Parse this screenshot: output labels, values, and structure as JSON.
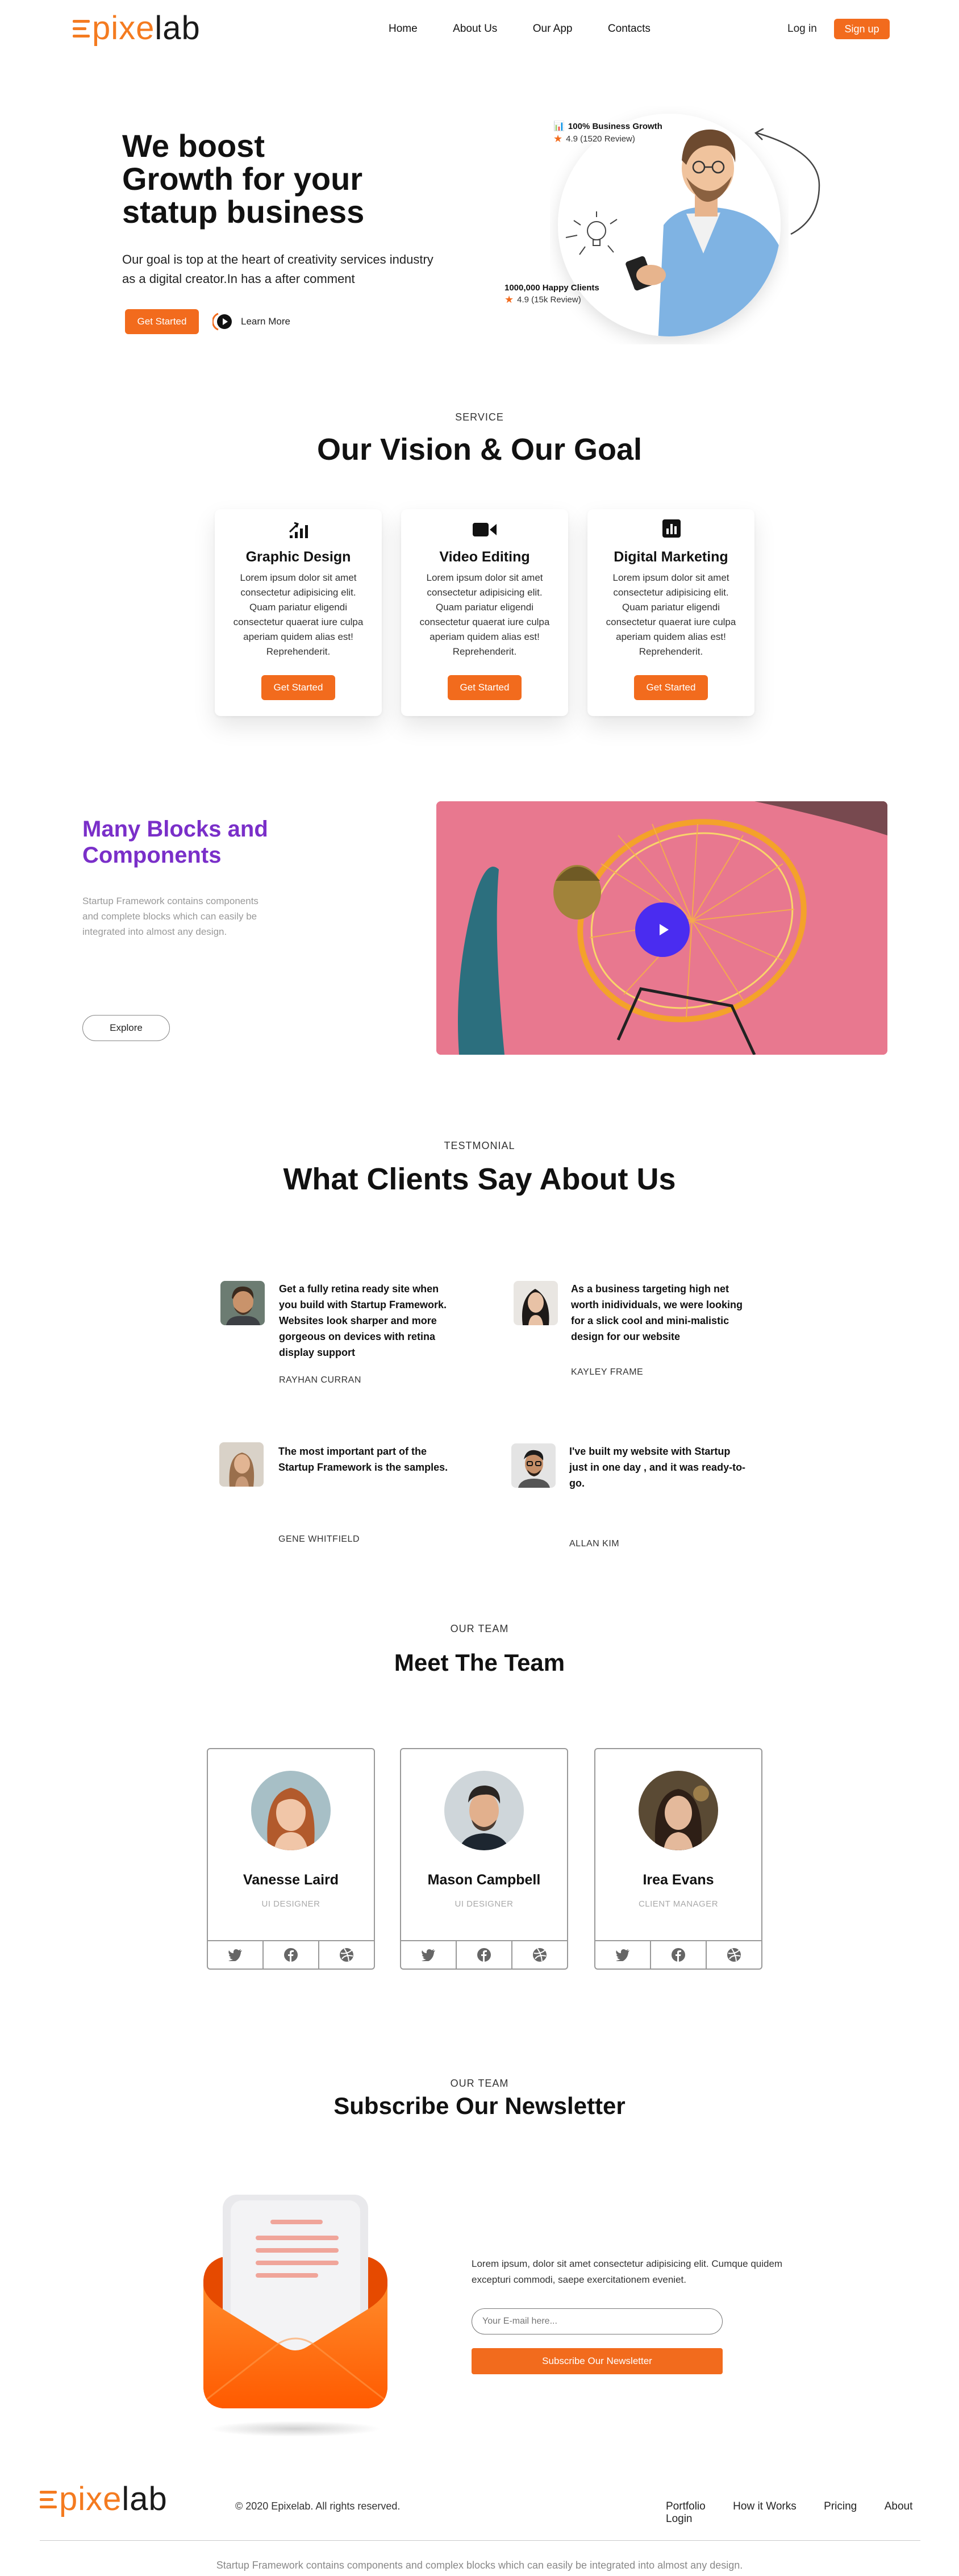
{
  "brand": {
    "logo_main": "pixe",
    "logo_tail": "lab"
  },
  "header": {
    "nav": [
      "Home",
      "About Us",
      "Our App",
      "Contacts"
    ],
    "login": "Log in",
    "signup": "Sign up"
  },
  "hero": {
    "title_line1": "We boost",
    "title_line2": "Growth for your",
    "title_line3": "statup business",
    "desc_line1": "Our goal is top at the heart of creativity services industry",
    "desc_line2": "as a digital creator.In has a after comment",
    "cta": "Get Started",
    "learn_more": "Learn More",
    "badge1_title": "100% Business Growth",
    "badge1_rating": "4.9 (1520 Review)",
    "badge2_title": "1000,000 Happy Clients",
    "badge2_rating": "4.9 (15k Review)"
  },
  "service": {
    "tag": "SERVICE",
    "title": "Our Vision & Our Goal",
    "cards": [
      {
        "title": "Graphic Design",
        "l1": "Lorem ipsum dolor sit amet",
        "l2": "consectetur adipisicing elit.",
        "l3": "Quam pariatur eligendi",
        "l4": "consectetur quaerat iure culpa",
        "l5": "aperiam quidem alias est!",
        "l6": "Reprehenderit.",
        "cta": "Get Started",
        "icon": "chart-scatter-icon"
      },
      {
        "title": "Video Editing",
        "l1": "Lorem ipsum dolor sit amet",
        "l2": "consectetur adipisicing elit.",
        "l3": "Quam pariatur eligendi",
        "l4": "consectetur quaerat iure culpa",
        "l5": "aperiam quidem alias est!",
        "l6": "Reprehenderit.",
        "cta": "Get Started",
        "icon": "video-camera-icon"
      },
      {
        "title": "Digital Marketing",
        "l1": "Lorem ipsum dolor sit amet",
        "l2": "consectetur adipisicing elit.",
        "l3": "Quam pariatur eligendi",
        "l4": "consectetur quaerat iure culpa",
        "l5": "aperiam quidem alias est!",
        "l6": "Reprehenderit.",
        "cta": "Get Started",
        "icon": "bar-chart-icon"
      }
    ]
  },
  "blocks": {
    "title_line1": "Many Blocks and",
    "title_line2": "Components",
    "desc_line1": "Startup Framework contains components",
    "desc_line2": "and complete blocks which can easily be",
    "desc_line3": "integrated into almost any design.",
    "explore": "Explore"
  },
  "testimonial": {
    "tag": "TESTMONIAL",
    "title": "What Clients Say About Us",
    "items": [
      {
        "l1": "Get a fully retina ready site when",
        "l2": "you build with Startup Framework.",
        "l3": "Websites look sharper and more",
        "l4": "gorgeous on devices with retina",
        "l5": "display support",
        "name": "RAYHAN CURRAN"
      },
      {
        "l1": "As a business targeting high net",
        "l2": "worth inidividuals, we were looking",
        "l3": "for a slick cool and mini-malistic",
        "l4": "design for our website",
        "l5": "",
        "name": "KAYLEY FRAME"
      },
      {
        "l1": "The most important part of the",
        "l2": "Startup Framework is the samples.",
        "l3": "",
        "l4": "",
        "l5": "",
        "name": "GENE WHITFIELD"
      },
      {
        "l1": "I've built my website with Startup",
        "l2": "just in one day , and it was ready-to-",
        "l3": "go.",
        "l4": "",
        "l5": "",
        "name": "ALLAN KIM"
      }
    ]
  },
  "team": {
    "tag": "OUR TEAM",
    "title": "Meet The Team",
    "members": [
      {
        "name": "Vanesse Laird",
        "role": "UI DESIGNER"
      },
      {
        "name": "Mason Campbell",
        "role": "UI DESIGNER"
      },
      {
        "name": "Irea Evans",
        "role": "CLIENT MANAGER"
      }
    ],
    "social_icons": [
      "twitter-icon",
      "facebook-icon",
      "dribbble-icon"
    ]
  },
  "newsletter": {
    "tag": "OUR TEAM",
    "title": "Subscribe Our Newsletter",
    "desc_line1": "Lorem ipsum, dolor sit amet consectetur adipisicing elit. Cumque quidem",
    "desc_line2": "excepturi commodi, saepe exercitationem eveniet.",
    "placeholder": "Your E-mail here...",
    "button": "Subscribe Our Newsletter"
  },
  "footer": {
    "copyright": "© 2020 Epixelab. All rights reserved.",
    "links": [
      "Portfolio",
      "How it Works",
      "Pricing",
      "About",
      "Login"
    ],
    "bottom": "Startup Framework contains components and complex blocks which can easily be integrated into almost any design."
  },
  "colors": {
    "accent": "#f26b1d",
    "purple": "#7a2fc9",
    "play": "#4a2cf0",
    "video_bg": "#e8788f"
  }
}
